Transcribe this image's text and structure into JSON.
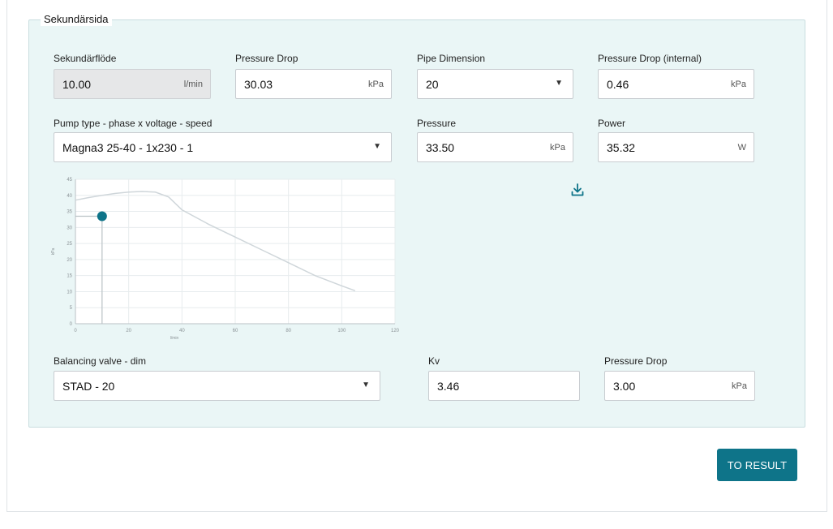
{
  "section": {
    "title": "Sekundärsida"
  },
  "fields": {
    "flow": {
      "label": "Sekundärflöde",
      "value": "10.00",
      "unit": "l/min"
    },
    "pressure_drop": {
      "label": "Pressure Drop",
      "value": "30.03",
      "unit": "kPa"
    },
    "pipe_dimension": {
      "label": "Pipe Dimension",
      "value": "20"
    },
    "pressure_drop_internal": {
      "label": "Pressure Drop (internal)",
      "value": "0.46",
      "unit": "kPa"
    },
    "pump_type": {
      "label": "Pump type - phase x voltage - speed",
      "value": "Magna3 25-40 - 1x230 - 1"
    },
    "pressure": {
      "label": "Pressure",
      "value": "33.50",
      "unit": "kPa"
    },
    "power": {
      "label": "Power",
      "value": "35.32",
      "unit": "W"
    },
    "balancing_valve": {
      "label": "Balancing valve - dim",
      "value": "STAD - 20"
    },
    "kv": {
      "label": "Kv",
      "value": "3.46"
    },
    "pressure_drop_valve": {
      "label": "Pressure Drop",
      "value": "3.00",
      "unit": "kPa"
    }
  },
  "icons": {
    "download": "download-icon",
    "dropdown": "caret-down-icon"
  },
  "actions": {
    "to_result": "TO RESULT"
  },
  "colors": {
    "accent": "#0e7489",
    "panel_bg": "#eaf6f6",
    "curve": "#cfd6da",
    "point": "#0e7489"
  },
  "chart_data": {
    "type": "line",
    "xlabel": "l/min",
    "ylabel": "kPa",
    "xlim": [
      0,
      120
    ],
    "ylim": [
      0,
      45
    ],
    "x_ticks": [
      0,
      20,
      40,
      60,
      80,
      100,
      120
    ],
    "y_ticks": [
      0,
      5,
      10,
      15,
      20,
      25,
      30,
      35,
      40,
      45
    ],
    "grid": true,
    "series": [
      {
        "x": [
          0,
          5,
          10,
          15,
          20,
          25,
          30,
          35,
          40,
          50,
          60,
          70,
          80,
          90,
          100,
          105
        ],
        "values": [
          38.5,
          39.3,
          40.0,
          40.6,
          41.0,
          41.2,
          41.0,
          39.5,
          35.5,
          31.0,
          27.0,
          23.0,
          19.0,
          15.0,
          11.8,
          10.3
        ]
      }
    ],
    "operating_point": {
      "x": 10,
      "y": 33.5
    }
  }
}
